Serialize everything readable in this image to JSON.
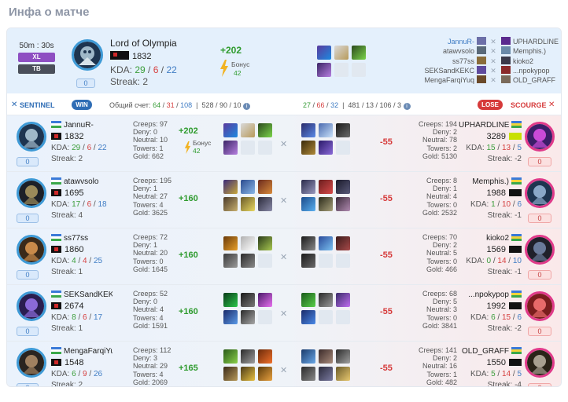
{
  "page_title": "Инфа о матче",
  "summary": {
    "duration": "50m : 30s",
    "tags": [
      "XL",
      "TB"
    ],
    "player_name": "Lord of Olympia",
    "rating": "1832",
    "kda_label": "KDA:",
    "kills": "29",
    "deaths": "6",
    "assists": "22",
    "streak": "Streak: 2",
    "counter": "0",
    "points_gain": "+202",
    "bonus_label": "Бонус",
    "bonus_value": "42",
    "opponents": [
      "JannuR-",
      "atawvsolo",
      "ss77ss",
      "SEKSandKEKC",
      "MengaFarqiYuq"
    ],
    "opponents_right": [
      "UPHARDLINE",
      "Memphis.)",
      "kioko2",
      "...npokypop",
      "OLD_GRAFF"
    ]
  },
  "bar": {
    "sentinel_label": "SENTINEL",
    "win_label": "WIN",
    "total_label": "Общий счет:",
    "sent_k": "64",
    "sent_d": "31",
    "sent_a": "108",
    "sent_extra": "528 / 90 / 10",
    "scourge_k": "27",
    "scourge_d": "66",
    "scourge_a": "32",
    "scourge_extra": "481 / 13 / 106 / 3",
    "lose_label": "LOSE",
    "scourge_label": "SCOURGE"
  },
  "rows": [
    {
      "left": {
        "name": "JannuR-",
        "rating": "1832",
        "k": "29",
        "d": "6",
        "a": "22",
        "streak": "Streak: 2",
        "counter": "0",
        "creeps": "Creeps: 97",
        "deny": "Deny: 0",
        "neutral": "Neutral: 10",
        "towers": "Towers: 1",
        "gold": "Gold: 662",
        "gain": "+202",
        "bonus_label": "Бонус",
        "bonus": "42"
      },
      "right": {
        "name": "UPHARDLINE",
        "rating": "3289",
        "k": "15",
        "d": "13",
        "a": "5",
        "streak": "Streak: -2",
        "counter": "0",
        "creeps": "Creeps: 194",
        "deny": "Deny: 2",
        "neutral": "Neutral: 78",
        "towers": "Towers: 2",
        "gold": "Gold: 5130",
        "loss": "-55"
      }
    },
    {
      "left": {
        "name": "atawvsolo",
        "rating": "1695",
        "k": "17",
        "d": "6",
        "a": "18",
        "streak": "Streak: 4",
        "counter": "0",
        "creeps": "Creeps: 195",
        "deny": "Deny: 1",
        "neutral": "Neutral: 27",
        "towers": "Towers: 4",
        "gold": "Gold: 3625",
        "gain": "+160"
      },
      "right": {
        "name": "Memphis.)",
        "rating": "1988",
        "k": "1",
        "d": "10",
        "a": "6",
        "streak": "Streak: -1",
        "counter": "0",
        "creeps": "Creeps: 8",
        "deny": "Deny: 1",
        "neutral": "Neutral: 4",
        "towers": "Towers: 0",
        "gold": "Gold: 2532",
        "loss": "-55"
      }
    },
    {
      "left": {
        "name": "ss77ss",
        "rating": "1860",
        "k": "4",
        "d": "4",
        "a": "25",
        "streak": "Streak: 1",
        "counter": "0",
        "creeps": "Creeps: 72",
        "deny": "Deny: 1",
        "neutral": "Neutral: 20",
        "towers": "Towers: 0",
        "gold": "Gold: 1645",
        "gain": "+160"
      },
      "right": {
        "name": "kioko2",
        "rating": "1569",
        "k": "0",
        "d": "14",
        "a": "10",
        "streak": "Streak: -1",
        "counter": "0",
        "creeps": "Creeps: 70",
        "deny": "Deny: 2",
        "neutral": "Neutral: 5",
        "towers": "Towers: 0",
        "gold": "Gold: 466",
        "loss": "-55"
      }
    },
    {
      "left": {
        "name": "SEKSandKEKC",
        "rating": "2674",
        "k": "8",
        "d": "6",
        "a": "17",
        "streak": "Streak: 1",
        "counter": "0",
        "creeps": "Creeps: 52",
        "deny": "Deny: 0",
        "neutral": "Neutral: 4",
        "towers": "Towers: 4",
        "gold": "Gold: 1591",
        "gain": "+160"
      },
      "right": {
        "name": "...npokypop",
        "rating": "1992",
        "k": "6",
        "d": "15",
        "a": "6",
        "streak": "Streak: -2",
        "counter": "0",
        "creeps": "Creeps: 68",
        "deny": "Deny: 5",
        "neutral": "Neutral: 3",
        "towers": "Towers: 0",
        "gold": "Gold: 3841",
        "loss": "-55"
      }
    },
    {
      "left": {
        "name": "MengaFarqiYuq",
        "rating": "1548",
        "k": "6",
        "d": "9",
        "a": "26",
        "streak": "Streak: 2",
        "counter": "0",
        "creeps": "Creeps: 112",
        "deny": "Deny: 3",
        "neutral": "Neutral: 29",
        "towers": "Towers: 4",
        "gold": "Gold: 2069",
        "gain": "+165"
      },
      "right": {
        "name": "OLD_GRAFF",
        "rating": "1550",
        "k": "5",
        "d": "14",
        "a": "5",
        "streak": "Streak: -4",
        "counter": "0",
        "creeps": "Creeps: 141",
        "deny": "Deny: 2",
        "neutral": "Neutral: 16",
        "towers": "Towers: 1",
        "gold": "Gold: 482",
        "loss": "-55"
      }
    }
  ],
  "colors": {
    "sentinel": "#2f6db5",
    "scourge": "#d63a3a",
    "gain": "#2e9b2e",
    "kills": "#3a9d3a",
    "assists": "#3f7cc4"
  },
  "icons": {
    "sentinel": "crossed-swords-icon",
    "scourge": "crossed-swords-icon",
    "info": "info-icon",
    "bonus": "lightning-bolt-icon"
  }
}
